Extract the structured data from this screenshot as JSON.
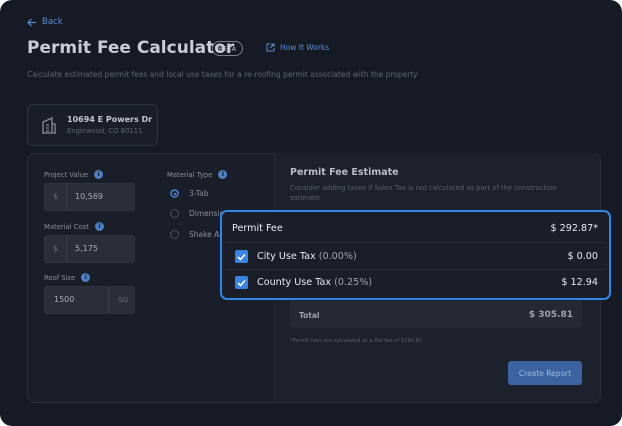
{
  "header": {
    "back_label": "Back",
    "title": "Permit Fee Calculator",
    "badge": "BETA",
    "how_it_works": "How It Works",
    "subtitle": "Calculate estimated permit fees and local use taxes for a re-roofing permit associated with the property"
  },
  "property": {
    "street": "10694 E Powers Dr",
    "city": "Englewood, CO 80111"
  },
  "form": {
    "project_value": {
      "label": "Project Value",
      "prefix": "$",
      "value": "10,569"
    },
    "material_cost": {
      "label": "Material Cost",
      "prefix": "$",
      "value": "5,175"
    },
    "roof_size": {
      "label": "Roof Size",
      "value": "1500",
      "unit": "SQ"
    },
    "material_type": {
      "label": "Material Type",
      "options": [
        "3-Tab",
        "Dimension",
        "Shake As"
      ],
      "selected": "3-Tab"
    }
  },
  "estimate": {
    "title": "Permit Fee Estimate",
    "subtitle": "Consider adding taxes if Sales Tax is not calculated as part of the construction estimate",
    "total_label": "Total",
    "total_value": "$ 305.81",
    "note": "*Permit fees are calculated as a flat fee of $292.87",
    "create_report": "Create Report"
  },
  "popup": {
    "permit_fee_label": "Permit Fee",
    "permit_fee_value": "$ 292.87*",
    "city_tax_label": "City Use Tax",
    "city_tax_rate": "(0.00%)",
    "city_tax_value": "$ 0.00",
    "city_tax_checked": true,
    "county_tax_label": "County Use Tax",
    "county_tax_rate": "(0.25%)",
    "county_tax_value": "$ 12.94",
    "county_tax_checked": true
  },
  "colors": {
    "background": "#161a24",
    "accent": "#2f86e6",
    "link": "#5b8fd6",
    "checkbox": "#3a83e0"
  }
}
